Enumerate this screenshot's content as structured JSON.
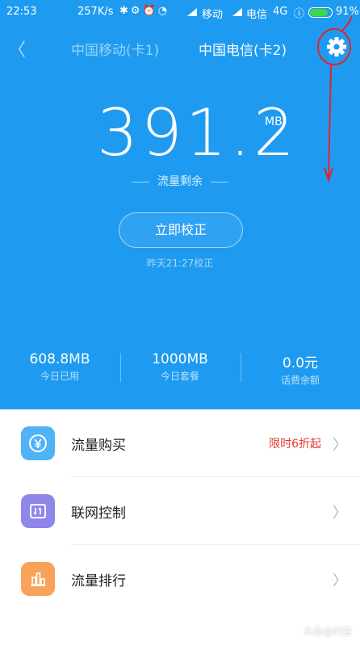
{
  "status_bar": {
    "time": "22:53",
    "speed": "257K/s",
    "carrier1": "移动",
    "carrier2": "电信",
    "network": "4G",
    "battery_percent": "91%",
    "battery_level": 0.91
  },
  "header": {
    "tab_sim1": "中国移动(卡1)",
    "tab_sim2": "中国电信(卡2)"
  },
  "data_remaining": {
    "value": "391.2",
    "unit": "MB",
    "label": "流量剩余"
  },
  "calibrate": {
    "button_label": "立即校正",
    "last_time": "昨天21:27校正"
  },
  "stats": [
    {
      "value": "608.8MB",
      "label": "今日已用"
    },
    {
      "value": "1000MB",
      "label": "今日套餐"
    },
    {
      "value": "0.0元",
      "label": "话费余额"
    }
  ],
  "menu": [
    {
      "label": "流量购买",
      "promo": "限时6折起",
      "icon": "yen-coin-icon",
      "color": "#4fb3f6"
    },
    {
      "label": "联网控制",
      "promo": "",
      "icon": "network-arrows-icon",
      "color": "#8e86e8"
    },
    {
      "label": "流量排行",
      "promo": "",
      "icon": "bar-chart-icon",
      "color": "#f8a25a"
    }
  ],
  "colors": {
    "hero_bg": "#1e9bf0",
    "promo_red": "#e53935",
    "annotation_red": "#e0242e"
  },
  "watermark": "头条@问答"
}
